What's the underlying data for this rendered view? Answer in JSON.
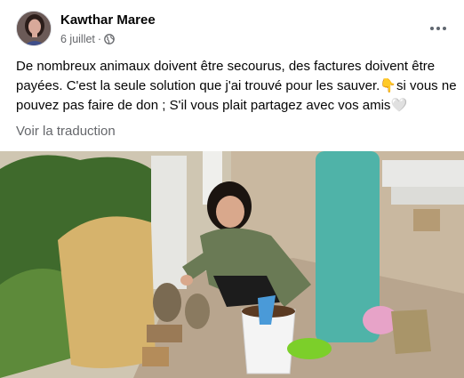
{
  "post": {
    "author": "Kawthar Maree",
    "date": "6 juillet",
    "privacy_icon": "globe-icon",
    "more_icon": "more-options-icon",
    "text_before_emoji": "De nombreux animaux doivent être secourus, des factures doivent être payées. C'est la seule solution que j'ai trouvé pour les sauver.",
    "emoji_point": "👇",
    "text_after_emoji": "si vous ne pouvez pas faire de don ; S'il vous plait partagez avec vos amis",
    "emoji_heart": "🤍",
    "translate_label": "Voir la traduction"
  },
  "colors": {
    "name": "#050505",
    "meta": "#65676b",
    "pole": "#4fb3a8",
    "bucket": "#f4f4f4",
    "jacket": "#6a7a55"
  }
}
